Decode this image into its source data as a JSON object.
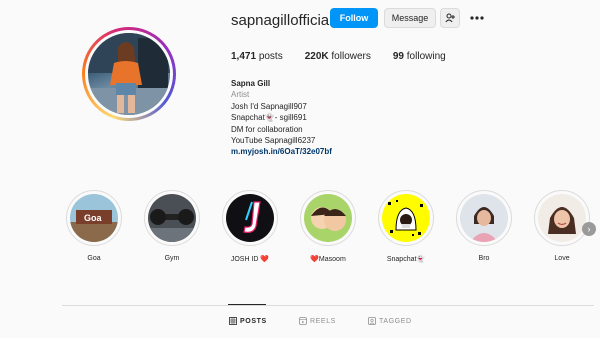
{
  "profile": {
    "username": "sapnagillofficial",
    "follow_label": "Follow",
    "message_label": "Message",
    "more_icon": "more-horizontal-icon",
    "add_user_icon": "add-user-icon"
  },
  "stats": {
    "posts_count": "1,471",
    "posts_label": "posts",
    "followers_count": "220K",
    "followers_label": "followers",
    "following_count": "99",
    "following_label": "following"
  },
  "bio": {
    "name": "Sapna Gill",
    "category": "Artist",
    "lines": [
      "Josh I'd Sapnagill907",
      "Snapchat👻- sgill691",
      "DM for collaboration",
      "YouTube Sapnagill6237"
    ],
    "link": "m.myjosh.in/6OaT/32e07bf"
  },
  "highlights": [
    {
      "label": "Goa"
    },
    {
      "label": "Gym"
    },
    {
      "label": "JOSH ID ❤️"
    },
    {
      "label": "❤️Masoom"
    },
    {
      "label": "Snapchat👻"
    },
    {
      "label": "Bro"
    },
    {
      "label": "Love"
    }
  ],
  "tabs": [
    {
      "label": "POSTS",
      "icon": "grid-icon",
      "active": true
    },
    {
      "label": "REELS",
      "icon": "reels-icon",
      "active": false
    },
    {
      "label": "TAGGED",
      "icon": "tag-icon",
      "active": false
    }
  ],
  "colors": {
    "accent": "#0095f6",
    "text": "#262626",
    "muted": "#8e8e8e",
    "link": "#00376b",
    "background": "#fafafa"
  }
}
